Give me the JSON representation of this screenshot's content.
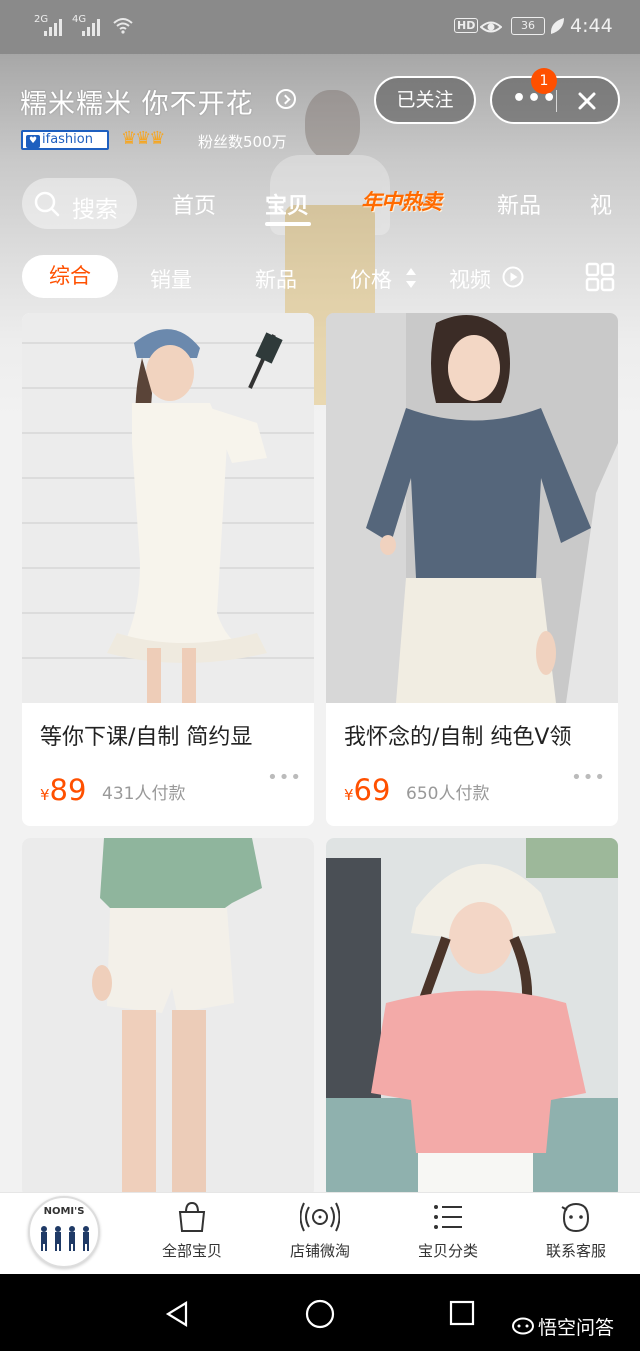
{
  "status_bar": {
    "signal1": "2G",
    "signal2": "4G",
    "hd": "HD",
    "battery": "36",
    "time": "4:44"
  },
  "shop": {
    "name": "糯米糯米 你不开花",
    "brand": "ifashion",
    "fans": "粉丝数500万",
    "follow_label": "已关注",
    "notification_count": "1"
  },
  "tabs": {
    "search": "搜索",
    "items": [
      "首页",
      "宝贝",
      "年中热卖",
      "新品",
      "视"
    ]
  },
  "filters": {
    "active": "综合",
    "items": [
      "销量",
      "新品",
      "价格",
      "视频"
    ]
  },
  "products": [
    {
      "title": "等你下课/自制 简约显",
      "currency": "¥",
      "price": "89",
      "sales": "431人付款"
    },
    {
      "title": "我怀念的/自制 纯色V领",
      "currency": "¥",
      "price": "69",
      "sales": "650人付款"
    },
    {
      "title": "",
      "currency": "",
      "price": "",
      "sales": ""
    },
    {
      "title": "",
      "currency": "",
      "price": "",
      "sales": ""
    }
  ],
  "bottom_nav": {
    "logo_text": "NOMI'S",
    "items": [
      "全部宝贝",
      "店铺微淘",
      "宝贝分类",
      "联系客服"
    ]
  },
  "watermark": "悟空问答",
  "colors": {
    "accent": "#ff5000",
    "promo": "#ff6a00",
    "brand_blue": "#1e5fbf"
  }
}
